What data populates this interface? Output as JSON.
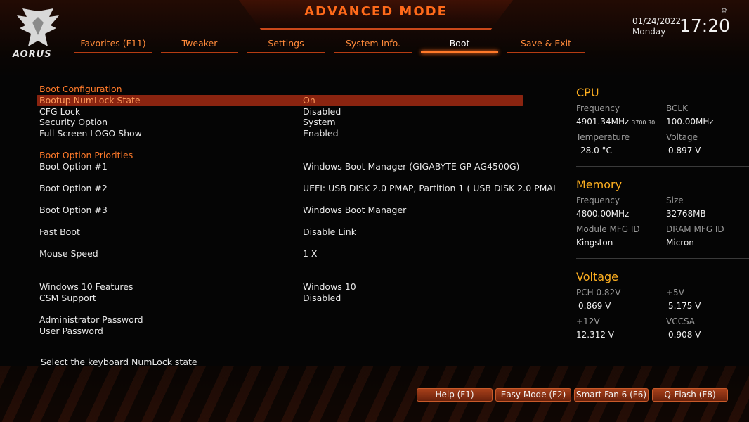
{
  "header": {
    "title": "ADVANCED MODE",
    "brand": "AORUS",
    "date": "01/24/2022",
    "weekday": "Monday",
    "time": "17:20",
    "settings_icon": "gear-icon"
  },
  "tabs": [
    {
      "label": "Favorites (F11)"
    },
    {
      "label": "Tweaker"
    },
    {
      "label": "Settings"
    },
    {
      "label": "System Info."
    },
    {
      "label": "Boot",
      "active": true
    },
    {
      "label": "Save & Exit"
    }
  ],
  "boot": {
    "config_header": "Boot Configuration",
    "numlock": {
      "label": "Bootup NumLock State",
      "value": "On"
    },
    "cfg_lock": {
      "label": "CFG Lock",
      "value": "Disabled"
    },
    "security": {
      "label": "Security Option",
      "value": "System"
    },
    "logo": {
      "label": "Full Screen LOGO Show",
      "value": "Enabled"
    },
    "priorities_header": "Boot Option Priorities",
    "opt1": {
      "label": "Boot Option #1",
      "value": "Windows Boot Manager (GIGABYTE GP-AG4500G)"
    },
    "opt2": {
      "label": "Boot Option #2",
      "value": "UEFI:  USB DISK 2.0 PMAP, Partition 1 ( USB DISK 2.0 PMAI"
    },
    "opt3": {
      "label": "Boot Option #3",
      "value": "Windows Boot Manager"
    },
    "fast_boot": {
      "label": "Fast Boot",
      "value": "Disable Link"
    },
    "mouse_speed": {
      "label": "Mouse Speed",
      "value": "1 X"
    },
    "win10": {
      "label": "Windows 10 Features",
      "value": "Windows 10"
    },
    "csm": {
      "label": "CSM Support",
      "value": "Disabled"
    },
    "admin_pw": {
      "label": "Administrator Password"
    },
    "user_pw": {
      "label": "User Password"
    }
  },
  "help_text": "Select the keyboard NumLock state",
  "cpu": {
    "title": "CPU",
    "freq_label": "Frequency",
    "freq_value": "4901.34MHz",
    "freq_sub": "3700.30",
    "bclk_label": "BCLK",
    "bclk_value": "100.00MHz",
    "temp_label": "Temperature",
    "temp_value": "28.0 °C",
    "volt_label": "Voltage",
    "volt_value": "0.897 V"
  },
  "memory": {
    "title": "Memory",
    "freq_label": "Frequency",
    "freq_value": "4800.00MHz",
    "size_label": "Size",
    "size_value": "32768MB",
    "module_label": "Module MFG ID",
    "module_value": "Kingston",
    "dram_label": "DRAM MFG ID",
    "dram_value": "Micron"
  },
  "voltage": {
    "title": "Voltage",
    "pch_label": "PCH 0.82V",
    "pch_value": "0.869 V",
    "p5_label": "+5V",
    "p5_value": "5.175 V",
    "p12_label": "+12V",
    "p12_value": "12.312 V",
    "vccsa_label": "VCCSA",
    "vccsa_value": "0.908 V"
  },
  "footer_buttons": {
    "help": "Help (F1)",
    "easy": "Easy Mode (F2)",
    "fan": "Smart Fan 6 (F6)",
    "qflash": "Q-Flash (F8)"
  },
  "colors": {
    "accent": "#ff7a2a",
    "highlight_row": "#8a2410",
    "panel_title": "#ffb020"
  }
}
